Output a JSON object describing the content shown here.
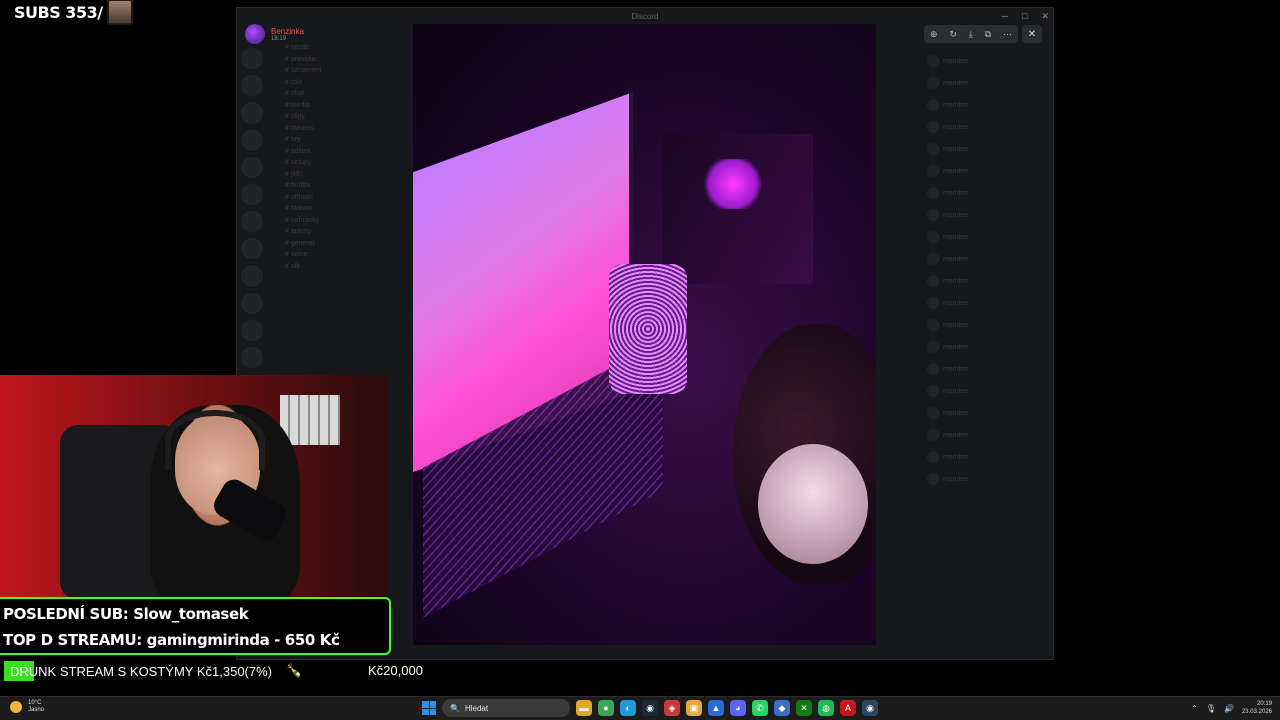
{
  "subs_counter": {
    "label": "SUBS 353/"
  },
  "discord": {
    "title": "Discord",
    "channels": [
      "# vitejte",
      "# pravidla",
      "# oznameni",
      "# role",
      "# chat",
      "# media",
      "# clipy",
      "# memes",
      "# hry",
      "# sdileni",
      "# setupy",
      "# jidlo",
      "# hudba",
      "# offtopic",
      "# stream",
      "# nahravky",
      "# ankety",
      "# general",
      "# voice",
      "# afk"
    ],
    "members": [
      "member",
      "member",
      "member",
      "member",
      "member",
      "member",
      "member",
      "member",
      "member",
      "member",
      "member",
      "member",
      "member",
      "member",
      "member",
      "member",
      "member",
      "member",
      "member",
      "member"
    ]
  },
  "image_viewer": {
    "author": "Benzinka",
    "time": "18:19",
    "toolbar_icons": [
      "zoom-in-icon",
      "rotate-icon",
      "download-icon",
      "open-external-icon",
      "more-icon"
    ],
    "close_icon": "close-icon"
  },
  "overlay": {
    "last_sub": "POSLEDNÍ SUB: Slow_tomasek",
    "top_donation": "TOP D STREAMU: gamingmirinda - 650 Kč",
    "goal_text": "DRUNK STREAM S KOSTÝMY Kč1,350(7%)",
    "goal_percent": 7,
    "goal_target": "Kč20,000",
    "goal_color": "#39e01f"
  },
  "taskbar": {
    "weather_temp": "10°C",
    "weather_desc": "Jasno",
    "search_placeholder": "Hledat",
    "apps": [
      {
        "name": "file-explorer-icon",
        "glyph": "▬",
        "color": "#e0a82e"
      },
      {
        "name": "chrome-icon",
        "glyph": "●",
        "color": "#3aa757"
      },
      {
        "name": "edge-icon",
        "glyph": "◐",
        "color": "#1f9ad6"
      },
      {
        "name": "steam-icon",
        "glyph": "◉",
        "color": "#1b2838"
      },
      {
        "name": "app-icon",
        "glyph": "◈",
        "color": "#c43b3b"
      },
      {
        "name": "notes-icon",
        "glyph": "▣",
        "color": "#e6a93a"
      },
      {
        "name": "photos-icon",
        "glyph": "▲",
        "color": "#2a6bd1"
      },
      {
        "name": "discord-icon",
        "glyph": "◕",
        "color": "#5865f2"
      },
      {
        "name": "whatsapp-icon",
        "glyph": "✆",
        "color": "#25d366"
      },
      {
        "name": "app2-icon",
        "glyph": "◆",
        "color": "#3b6fc4"
      },
      {
        "name": "xbox-icon",
        "glyph": "✕",
        "color": "#107c10"
      },
      {
        "name": "spotify-icon",
        "glyph": "◍",
        "color": "#1db954"
      },
      {
        "name": "adobe-icon",
        "glyph": "A",
        "color": "#c4161c"
      },
      {
        "name": "steam2-icon",
        "glyph": "◉",
        "color": "#2a475e"
      }
    ],
    "time": "20:19",
    "date": "23.03.2026"
  }
}
